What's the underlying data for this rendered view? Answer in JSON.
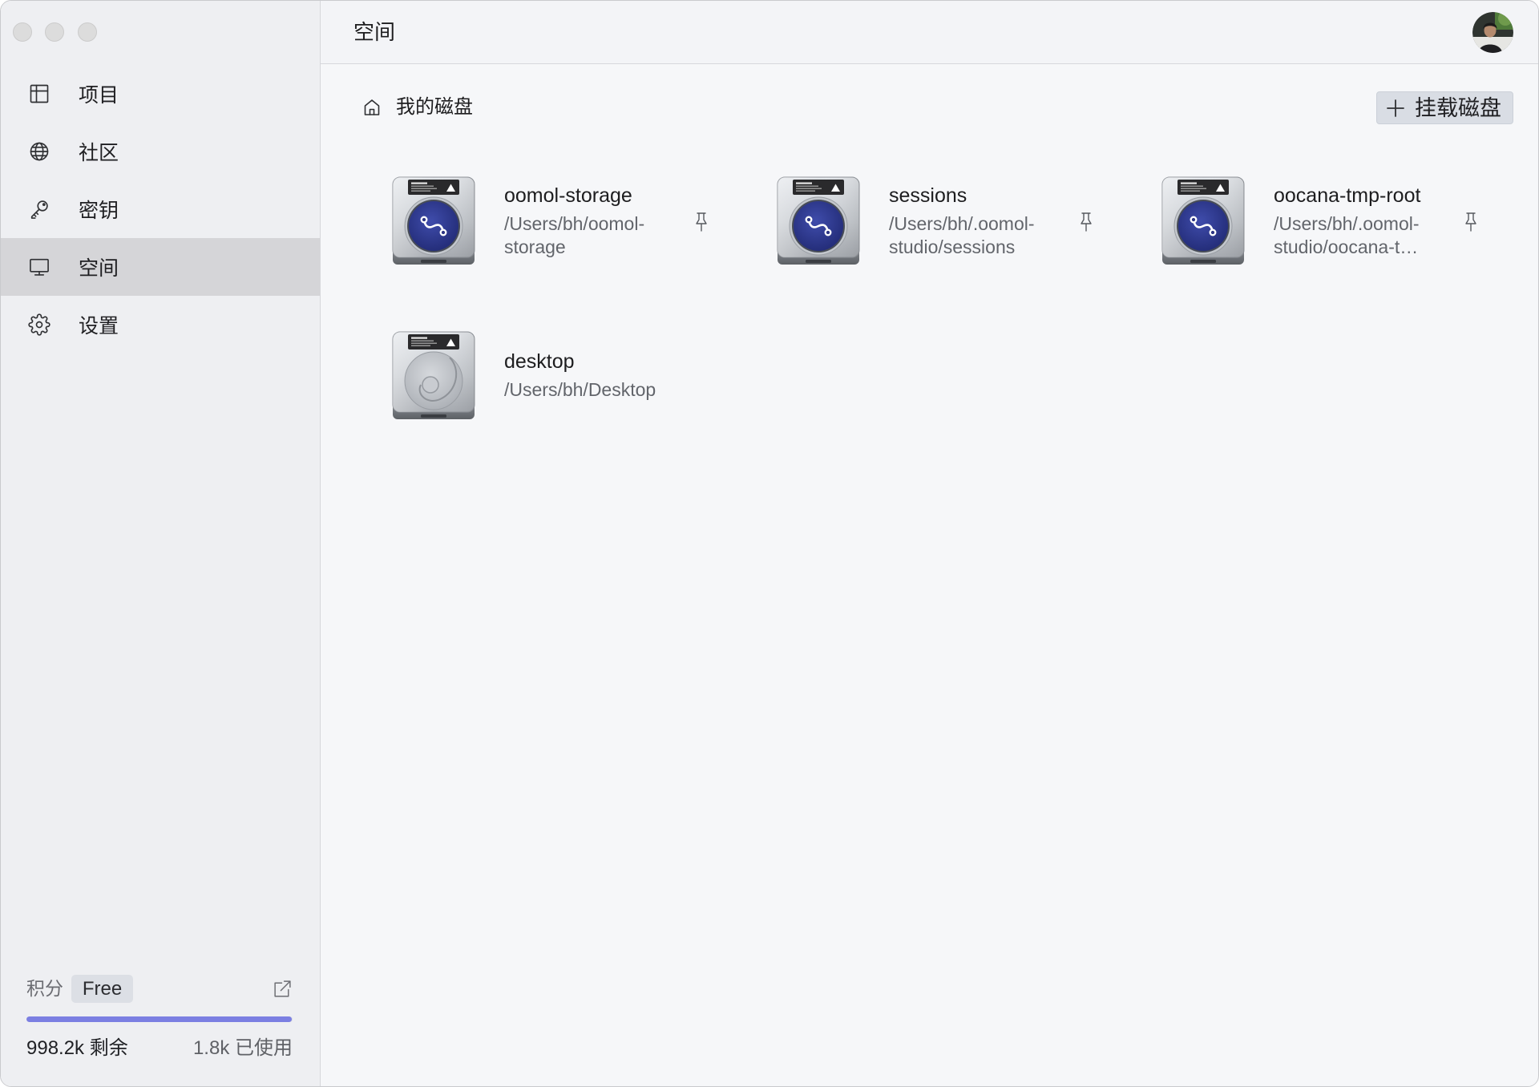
{
  "header": {
    "title": "空间",
    "avatar_icon": "user-avatar-icon"
  },
  "sidebar": {
    "items": [
      {
        "label": "项目",
        "icon": "layout-icon"
      },
      {
        "label": "社区",
        "icon": "globe-icon"
      },
      {
        "label": "密钥",
        "icon": "key-icon"
      },
      {
        "label": "空间",
        "icon": "monitor-icon",
        "selected": true
      },
      {
        "label": "设置",
        "icon": "gear-icon"
      }
    ],
    "credits": {
      "label": "积分",
      "plan_badge": "Free",
      "link_icon": "external-link-icon",
      "remaining": {
        "value": "998.2k",
        "label": "剩余"
      },
      "used": {
        "value": "1.8k",
        "label": "已使用"
      },
      "remaining_fraction": 0.998
    }
  },
  "main": {
    "breadcrumb": {
      "icon": "home-icon",
      "label": "我的磁盘"
    },
    "mount_button": {
      "icon": "plus-icon",
      "label": "挂载磁盘"
    },
    "disks": [
      {
        "name": "oomol-storage",
        "path": "/Users/bh/oomol-storage",
        "icon": "hard-drive-app-icon",
        "action_icon": "pin-icon"
      },
      {
        "name": "sessions",
        "path": "/Users/bh/.oomol-studio/sessions",
        "icon": "hard-drive-app-icon",
        "action_icon": "pin-icon"
      },
      {
        "name": "oocana-tmp-root",
        "path": "/Users/bh/.oomol-studio/oocana-t…",
        "icon": "hard-drive-app-icon",
        "action_icon": "pin-icon"
      },
      {
        "name": "desktop",
        "path": "/Users/bh/Desktop",
        "icon": "hard-drive-icon"
      }
    ]
  },
  "theme": {
    "accent": "#7b7fe2",
    "selected_nav_bg": "#d5d5d8",
    "sidebar_bg": "#eeeff2",
    "content_bg": "#f6f7f9"
  }
}
